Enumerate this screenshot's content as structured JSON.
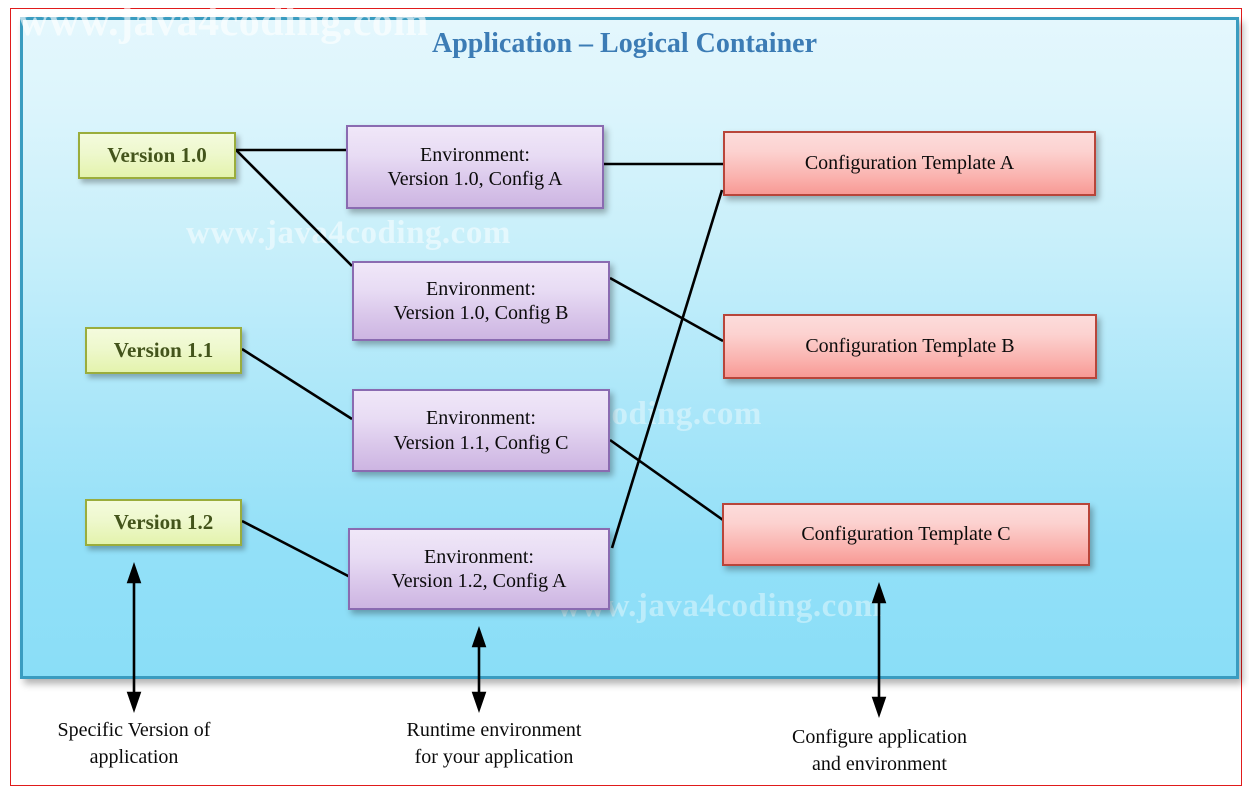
{
  "title": "Application – Logical Container",
  "watermarks": [
    "www.java4coding.com",
    "www.java4coding.com",
    "www.java4coding.com",
    "www.java4coding.com"
  ],
  "versions": [
    {
      "label": "Version 1.0"
    },
    {
      "label": "Version 1.1"
    },
    {
      "label": "Version 1.2"
    }
  ],
  "environments": [
    {
      "line1": "Environment:",
      "line2": "Version 1.0, Config A"
    },
    {
      "line1": "Environment:",
      "line2": "Version 1.0, Config B"
    },
    {
      "line1": "Environment:",
      "line2": "Version 1.1, Config C"
    },
    {
      "line1": "Environment:",
      "line2": "Version 1.2, Config A"
    }
  ],
  "configs": [
    {
      "label": "Configuration Template A"
    },
    {
      "label": "Configuration Template B"
    },
    {
      "label": "Configuration Template C"
    }
  ],
  "captions": [
    {
      "line1": "Specific Version of",
      "line2": "application"
    },
    {
      "line1": "Runtime environment",
      "line2": "for your application"
    },
    {
      "line1": "Configure application",
      "line2": "and environment"
    }
  ],
  "colors": {
    "title": "#3c7cb5",
    "container_border": "#3a9cc0",
    "container_fill": "#8adef7",
    "version_border": "#9aad3c",
    "version_fill": "#e4f3ad",
    "version_text": "#43541b",
    "env_border": "#8a6bb1",
    "env_fill": "#cdb5e2",
    "config_border": "#b8453a",
    "config_fill": "#f89a95",
    "slide_border": "#e01b1b",
    "connector": "#000000"
  }
}
